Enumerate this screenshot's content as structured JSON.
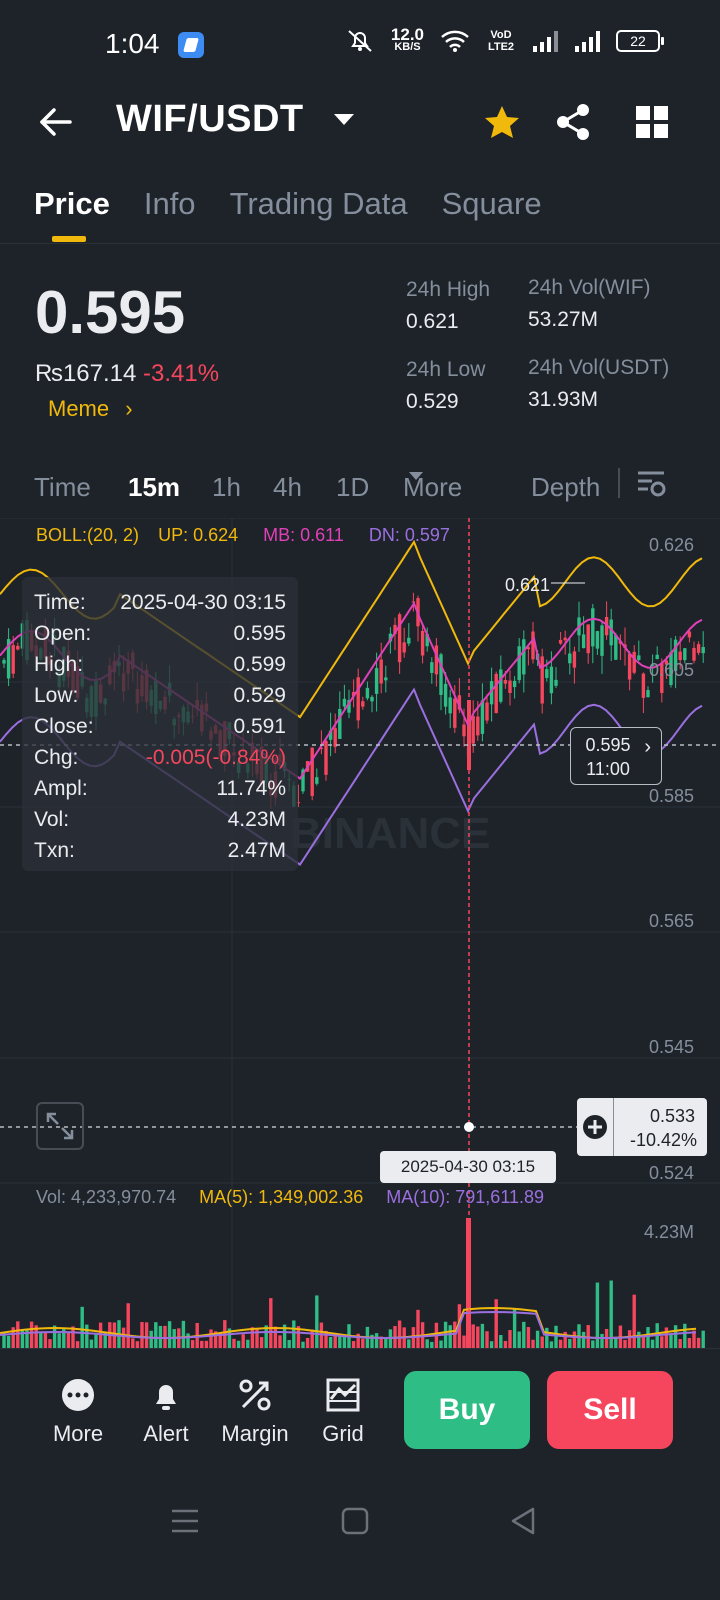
{
  "status_bar": {
    "time": "1:04",
    "net_speed_value": "12.0",
    "net_speed_unit": "KB/S",
    "volte": "VoD LTE2",
    "battery": "22",
    "icons": [
      "app-icon",
      "mute-icon",
      "wifi-icon",
      "signal-icon",
      "signal-icon",
      "battery-icon"
    ]
  },
  "header": {
    "pair": "WIF/USDT",
    "icons": [
      "back-arrow-icon",
      "caret-down-icon",
      "star-icon",
      "share-icon",
      "grid-icon"
    ],
    "star_color": "#f0b90b"
  },
  "tabs": [
    {
      "label": "Price",
      "active": true
    },
    {
      "label": "Info",
      "active": false
    },
    {
      "label": "Trading Data",
      "active": false
    },
    {
      "label": "Square",
      "active": false
    }
  ],
  "ticker": {
    "price": "0.595",
    "inr_price": "₨167.14",
    "change": "-3.41%",
    "tag": "Meme",
    "tag_arrow": "›",
    "high_label": "24h High",
    "high": "0.621",
    "low_label": "24h Low",
    "low": "0.529",
    "vol_base_label": "24h Vol(WIF)",
    "vol_base": "53.27M",
    "vol_quote_label": "24h Vol(USDT)",
    "vol_quote": "31.93M"
  },
  "intervals": {
    "time": "Time",
    "m15": "15m",
    "h1": "1h",
    "h4": "4h",
    "d1": "1D",
    "more": "More",
    "depth": "Depth"
  },
  "boll": {
    "label": "BOLL:(20, 2)",
    "up": "UP: 0.624",
    "mb": "MB: 0.611",
    "dn": "DN: 0.597",
    "colors": {
      "up": "#f0b90b",
      "mb": "#e040b8",
      "dn": "#9b6fe0"
    }
  },
  "tooltip": {
    "rows": [
      {
        "k": "Time:",
        "v": "2025-04-30 03:15"
      },
      {
        "k": "Open:",
        "v": "0.595"
      },
      {
        "k": "High:",
        "v": "0.599"
      },
      {
        "k": "Low:",
        "v": "0.529"
      },
      {
        "k": "Close:",
        "v": "0.591"
      },
      {
        "k": "Chg:",
        "v": "-0.005(-0.84%)"
      },
      {
        "k": "Ampl:",
        "v": "11.74%"
      },
      {
        "k": "Vol:",
        "v": "4.23M"
      },
      {
        "k": "Txn:",
        "v": "2.47M"
      }
    ]
  },
  "price_axis": [
    "0.626",
    "0.605",
    "0.585",
    "0.565",
    "0.545",
    "0.524"
  ],
  "chart_marks": {
    "local_high": "0.621",
    "last_price": "0.595",
    "last_countdown": "11:00",
    "cross_price": "0.533",
    "cross_change": "-10.42%",
    "cross_date": "2025-04-30 03:15",
    "watermark": "BINANCE"
  },
  "volume": {
    "vol": "Vol: 4,233,970.74",
    "ma5": "MA(5): 1,349,002.36",
    "ma10": "MA(10): 791,611.89",
    "axis_top": "4.23M"
  },
  "chart_data": {
    "type": "candlestick",
    "interval": "15m",
    "ylim": [
      0.524,
      0.626
    ],
    "selected": {
      "time": "2025-04-30 03:15",
      "open": 0.595,
      "high": 0.599,
      "low": 0.529,
      "close": 0.591,
      "volume": "4.23M"
    },
    "indicators": {
      "BOLL": {
        "period": 20,
        "k": 2,
        "up": 0.624,
        "mb": 0.611,
        "dn": 0.597
      },
      "volume_ma5": 1349002.36,
      "volume_ma10": 791611.89
    }
  },
  "bottom_bar": {
    "more": "More",
    "alert": "Alert",
    "margin": "Margin",
    "grid": "Grid",
    "buy": "Buy",
    "sell": "Sell",
    "buy_color": "#2ebd85",
    "sell_color": "#f6465d"
  }
}
